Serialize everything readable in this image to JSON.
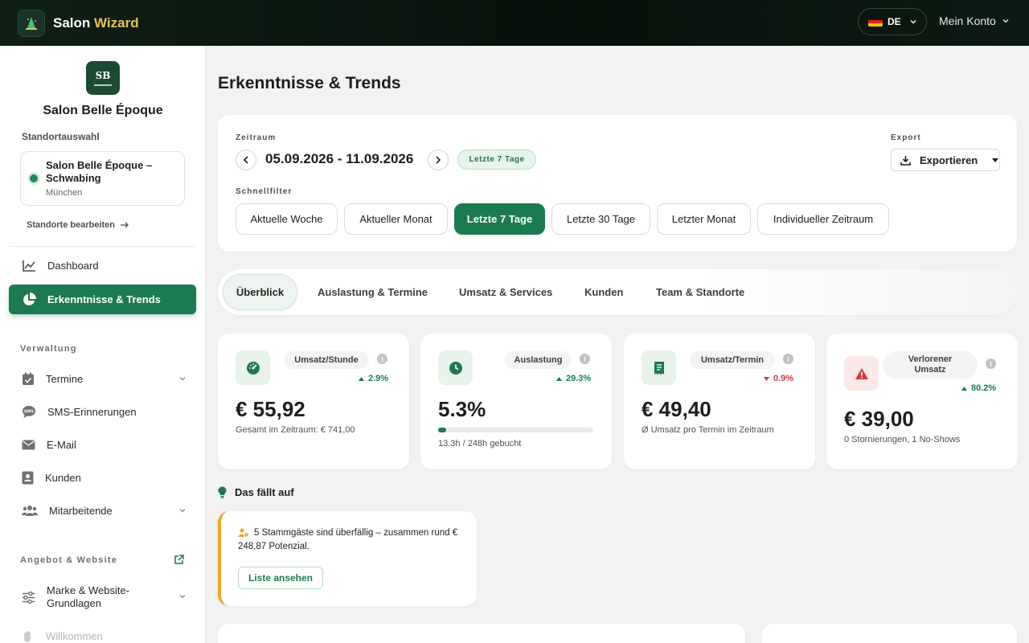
{
  "app": {
    "brand_main": "Salon ",
    "brand_accent": "Wizard"
  },
  "header": {
    "language": "DE",
    "account": "Mein Konto"
  },
  "sidebar": {
    "salon_initials": "SB",
    "salon_name": "Salon Belle Époque",
    "location_label": "Standortauswahl",
    "location_name": "Salon Belle Époque – Schwabing",
    "location_city": "München",
    "edit_locations": "Standorte bearbeiten",
    "nav": [
      {
        "label": "Dashboard",
        "icon": "line-chart-icon"
      },
      {
        "label": "Erkenntnisse & Trends",
        "icon": "pie-chart-icon",
        "active": true
      }
    ],
    "group_admin": "Verwaltung",
    "admin_items": [
      {
        "label": "Termine",
        "icon": "calendar-check-icon"
      },
      {
        "label": "SMS-Erinnerungen",
        "icon": "sms-icon"
      },
      {
        "label": "E-Mail",
        "icon": "envelope-icon"
      },
      {
        "label": "Kunden",
        "icon": "contact-card-icon"
      },
      {
        "label": "Mitarbeitende",
        "icon": "users-icon"
      }
    ],
    "group_offer": "Angebot & Website",
    "offer_items": [
      {
        "label": "Marke & Website-Grundlagen",
        "icon": "sliders-icon"
      },
      {
        "label": "Willkommen",
        "icon": "hand-icon"
      }
    ]
  },
  "main": {
    "title": "Erkenntnisse & Trends",
    "period_label": "Zeitraum",
    "period_range": "05.09.2026 - 11.09.2026",
    "period_badge": "Letzte 7 Tage",
    "export_label": "Export",
    "export_button": "Exportieren",
    "quickfilter_label": "Schnellfilter",
    "quickfilters": [
      "Aktuelle Woche",
      "Aktueller Monat",
      "Letzte 7 Tage",
      "Letzte 30 Tage",
      "Letzter Monat",
      "Individueller Zeitraum"
    ],
    "quickfilter_active": "Letzte 7 Tage",
    "tabs": [
      "Überblick",
      "Auslastung & Termine",
      "Umsatz & Services",
      "Kunden",
      "Team & Standorte"
    ],
    "tab_active": "Überblick",
    "kpis": [
      {
        "label": "Umsatz/Stunde",
        "change": "2.9%",
        "direction": "up",
        "value": "€ 55,92",
        "sub": "Gesamt im Zeitraum: € 741,00"
      },
      {
        "label": "Auslastung",
        "change": "29.3%",
        "direction": "up",
        "value": "5.3%",
        "sub": "13.3h / 248h gebucht",
        "progress": 0.053
      },
      {
        "label": "Umsatz/Termin",
        "change": "0.9%",
        "direction": "down",
        "value": "€ 49,40",
        "sub": "Ø Umsatz pro Termin im Zeitraum"
      },
      {
        "label": "Verlorener Umsatz",
        "change": "80.2%",
        "direction": "up",
        "value": "€ 39,00",
        "sub": "0 Stornierungen, 1 No-Shows"
      }
    ],
    "insights_title": "Das fällt auf",
    "insight_text": "5 Stammgäste sind überfällig – zusammen rund € 248,87 Potenzial.",
    "insight_button": "Liste ansehen"
  },
  "colors": {
    "accent": "#1c7a50",
    "brand_gold": "#e8c15a",
    "warning": "#f2a524",
    "danger": "#d03a3a"
  }
}
